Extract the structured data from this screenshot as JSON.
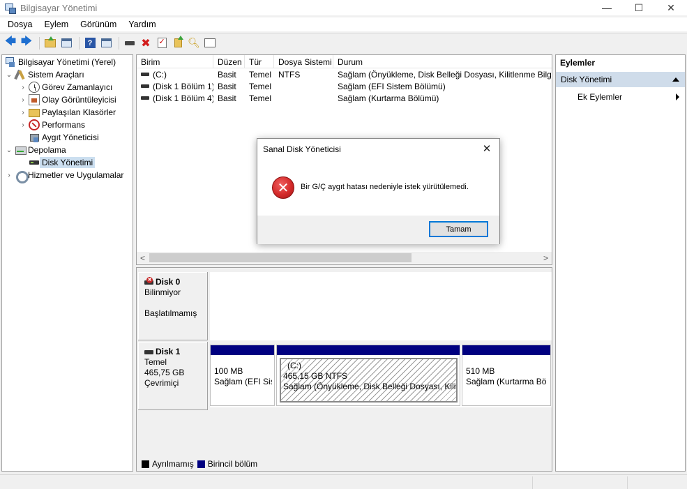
{
  "window": {
    "title": "Bilgisayar Yönetimi",
    "minimize": "—",
    "maximize": "☐",
    "close": "✕"
  },
  "menu": [
    "Dosya",
    "Eylem",
    "Görünüm",
    "Yardım"
  ],
  "toolbar": {
    "back": "🡄",
    "forward": "🡆",
    "delete": "✖"
  },
  "tree": {
    "root": "Bilgisayar Yönetimi (Yerel)",
    "system_tools": "Sistem Araçları",
    "task_scheduler": "Görev Zamanlayıcı",
    "event_viewer": "Olay Görüntüleyicisi",
    "shared_folders": "Paylaşılan Klasörler",
    "performance": "Performans",
    "device_manager": "Aygıt Yöneticisi",
    "storage": "Depolama",
    "disk_management": "Disk Yönetimi",
    "services": "Hizmetler ve Uygulamalar",
    "expanded_glyph": "⌄",
    "collapsed_glyph": "›"
  },
  "volume_list": {
    "columns": [
      "Birim",
      "Düzen",
      "Tür",
      "Dosya Sistemi",
      "Durum"
    ],
    "rows": [
      [
        "(C:)",
        "Basit",
        "Temel",
        "NTFS",
        "Sağlam (Önyükleme, Disk Belleği Dosyası, Kilitlenme Bilgisi"
      ],
      [
        "(Disk 1 Bölüm 1)",
        "Basit",
        "Temel",
        "",
        "Sağlam (EFI Sistem Bölümü)"
      ],
      [
        "(Disk 1 Bölüm 4)",
        "Basit",
        "Temel",
        "",
        "Sağlam (Kurtarma Bölümü)"
      ]
    ],
    "scroll_left": "<",
    "scroll_right": ">"
  },
  "disks": [
    {
      "name": "Disk 0",
      "type": "Bilinmiyor",
      "size": "",
      "status": "Başlatılmamış"
    },
    {
      "name": "Disk 1",
      "type": "Temel",
      "size": "465,75 GB",
      "status": "Çevrimiçi"
    }
  ],
  "partitions": [
    {
      "label": "",
      "size": "100 MB",
      "status": "Sağlam (EFI Sis"
    },
    {
      "label": "(C:)",
      "size": "465,15 GB NTFS",
      "status": "Sağlam (Önyükleme, Disk Belleği Dosyası, Kilitle"
    },
    {
      "label": "",
      "size": "510 MB",
      "status": "Sağlam (Kurtarma Bö"
    }
  ],
  "legend": [
    {
      "label": "Ayrılmamış",
      "color": "#000000"
    },
    {
      "label": "Birincil bölüm",
      "color": "#000080"
    }
  ],
  "actions": {
    "header": "Eylemler",
    "section": "Disk Yönetimi",
    "item": "Ek Eylemler"
  },
  "dialog": {
    "title": "Sanal Disk Yöneticisi",
    "message": "Bir G/Ç aygıt hatası nedeniyle istek yürütülemedi.",
    "ok": "Tamam",
    "close": "✕",
    "error_glyph": "✕"
  }
}
